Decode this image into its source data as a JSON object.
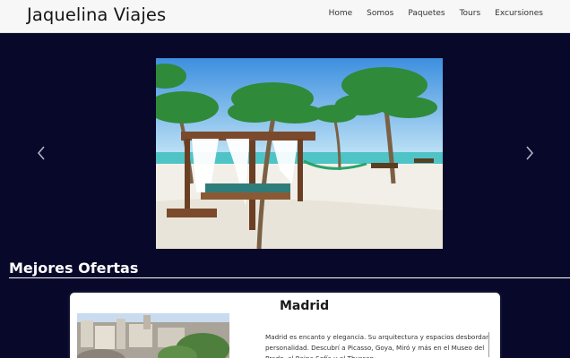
{
  "header": {
    "brand": "Jaquelina Viajes",
    "nav": [
      "Home",
      "Somos",
      "Paquetes",
      "Tours",
      "Excursiones"
    ]
  },
  "carousel": {
    "prev_icon": "chevron-left-icon",
    "next_icon": "chevron-right-icon"
  },
  "offers": {
    "heading": "Mejores Ofertas",
    "card": {
      "title": "Madrid",
      "description": "Madrid es encanto y elegancia. Su arquitectura y espacios desbordan personalidad. Descubrí a Picasso, Goya, Miró y más en el Museo del Prado, el Reina Sofía y el Thyssen."
    }
  },
  "colors": {
    "page_bg": "#08082a",
    "navbar_bg": "#f7f7f7",
    "heading_text": "#ffffff"
  }
}
